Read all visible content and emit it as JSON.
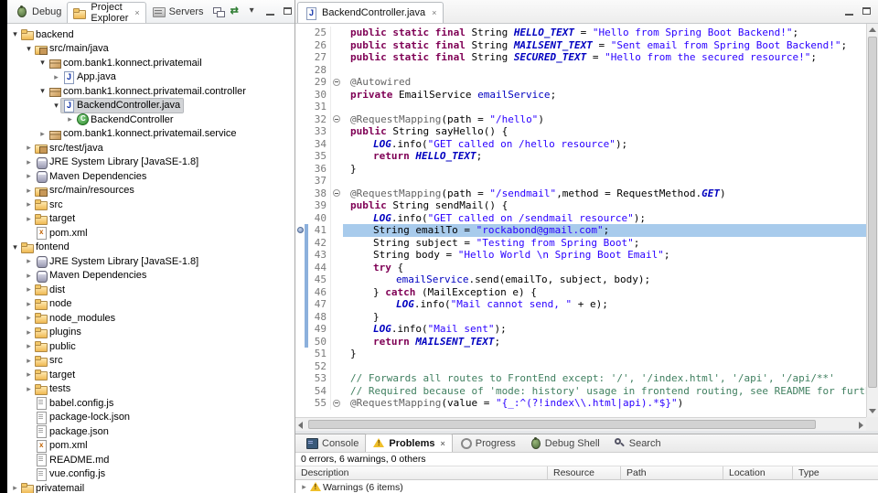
{
  "left_toolbar": {
    "tabs": [
      {
        "label": "Debug",
        "icon": "bug",
        "active": false,
        "closable": false
      },
      {
        "label": "Project Explorer",
        "icon": "explorer",
        "active": true,
        "closable": true
      },
      {
        "label": "Servers",
        "icon": "server",
        "active": false,
        "closable": false
      }
    ],
    "actions": [
      "collapse-all",
      "link-with-editor",
      "view-menu",
      "minimize",
      "maximize"
    ]
  },
  "project_tree": {
    "items": [
      {
        "label": "backend",
        "depth": 0,
        "state": "e",
        "icon": "prj"
      },
      {
        "label": "src/main/java",
        "depth": 1,
        "state": "e",
        "icon": "srcf"
      },
      {
        "label": "com.bank1.konnect.privatemail",
        "depth": 2,
        "state": "e",
        "icon": "pkg"
      },
      {
        "label": "App.java",
        "depth": 3,
        "state": "c",
        "icon": "jfile"
      },
      {
        "label": "com.bank1.konnect.privatemail.controller",
        "depth": 2,
        "state": "e",
        "icon": "pkg"
      },
      {
        "label": "BackendController.java",
        "depth": 3,
        "state": "e",
        "icon": "jfile",
        "sel": true
      },
      {
        "label": "BackendController",
        "depth": 4,
        "state": "c",
        "icon": "cls"
      },
      {
        "label": "com.bank1.konnect.privatemail.service",
        "depth": 2,
        "state": "c",
        "icon": "pkg"
      },
      {
        "label": "src/test/java",
        "depth": 1,
        "state": "c",
        "icon": "srcf"
      },
      {
        "label": "JRE System Library [JavaSE-1.8]",
        "depth": 1,
        "state": "c",
        "icon": "lib"
      },
      {
        "label": "Maven Dependencies",
        "depth": 1,
        "state": "c",
        "icon": "lib"
      },
      {
        "label": "src/main/resources",
        "depth": 1,
        "state": "c",
        "icon": "srcf"
      },
      {
        "label": "src",
        "depth": 1,
        "state": "c",
        "icon": "fold"
      },
      {
        "label": "target",
        "depth": 1,
        "state": "c",
        "icon": "fold"
      },
      {
        "label": "pom.xml",
        "depth": 1,
        "state": "",
        "icon": "xml"
      },
      {
        "label": "fontend",
        "depth": 0,
        "state": "e",
        "icon": "prj"
      },
      {
        "label": "JRE System Library [JavaSE-1.8]",
        "depth": 1,
        "state": "c",
        "icon": "lib"
      },
      {
        "label": "Maven Dependencies",
        "depth": 1,
        "state": "c",
        "icon": "lib"
      },
      {
        "label": "dist",
        "depth": 1,
        "state": "c",
        "icon": "fold"
      },
      {
        "label": "node",
        "depth": 1,
        "state": "c",
        "icon": "fold"
      },
      {
        "label": "node_modules",
        "depth": 1,
        "state": "c",
        "icon": "fold"
      },
      {
        "label": "plugins",
        "depth": 1,
        "state": "c",
        "icon": "fold"
      },
      {
        "label": "public",
        "depth": 1,
        "state": "c",
        "icon": "fold"
      },
      {
        "label": "src",
        "depth": 1,
        "state": "c",
        "icon": "fold"
      },
      {
        "label": "target",
        "depth": 1,
        "state": "c",
        "icon": "fold"
      },
      {
        "label": "tests",
        "depth": 1,
        "state": "c",
        "icon": "fold"
      },
      {
        "label": "babel.config.js",
        "depth": 1,
        "state": "",
        "icon": "file"
      },
      {
        "label": "package-lock.json",
        "depth": 1,
        "state": "",
        "icon": "file"
      },
      {
        "label": "package.json",
        "depth": 1,
        "state": "",
        "icon": "file"
      },
      {
        "label": "pom.xml",
        "depth": 1,
        "state": "",
        "icon": "xml"
      },
      {
        "label": "README.md",
        "depth": 1,
        "state": "",
        "icon": "file"
      },
      {
        "label": "vue.config.js",
        "depth": 1,
        "state": "",
        "icon": "file"
      },
      {
        "label": "privatemail",
        "depth": 0,
        "state": "c",
        "icon": "prj"
      }
    ]
  },
  "editor": {
    "tab_label": "BackendController.java",
    "lines": [
      {
        "n": 25,
        "ind": 0,
        "seg": [
          [
            "k",
            "public static final "
          ],
          [
            "d",
            "String "
          ],
          [
            "sf",
            "HELLO_TEXT"
          ],
          [
            "d",
            " = "
          ],
          [
            "s",
            "\"Hello from Spring Boot Backend!\""
          ],
          [
            "d",
            ";"
          ]
        ]
      },
      {
        "n": 26,
        "ind": 0,
        "seg": [
          [
            "k",
            "public static final "
          ],
          [
            "d",
            "String "
          ],
          [
            "sf",
            "MAILSENT_TEXT"
          ],
          [
            "d",
            " = "
          ],
          [
            "s",
            "\"Sent email from Spring Boot Backend!\""
          ],
          [
            "d",
            ";"
          ]
        ]
      },
      {
        "n": 27,
        "ind": 0,
        "seg": [
          [
            "k",
            "public static final "
          ],
          [
            "d",
            "String "
          ],
          [
            "sf",
            "SECURED_TEXT"
          ],
          [
            "d",
            " = "
          ],
          [
            "s",
            "\"Hello from the secured resource!\""
          ],
          [
            "d",
            ";"
          ]
        ]
      },
      {
        "n": 28,
        "ind": 0,
        "seg": []
      },
      {
        "n": 29,
        "ind": 0,
        "fold": true,
        "seg": [
          [
            "a",
            "@Autowired"
          ]
        ]
      },
      {
        "n": 30,
        "ind": 0,
        "seg": [
          [
            "k",
            "private "
          ],
          [
            "d",
            "EmailService "
          ],
          [
            "fl",
            "emailService"
          ],
          [
            "d",
            ";"
          ]
        ]
      },
      {
        "n": 31,
        "ind": 0,
        "seg": []
      },
      {
        "n": 32,
        "ind": 0,
        "fold": true,
        "seg": [
          [
            "a",
            "@RequestMapping"
          ],
          [
            "d",
            "(path = "
          ],
          [
            "s",
            "\"/hello\""
          ],
          [
            "d",
            ")"
          ]
        ]
      },
      {
        "n": 33,
        "ind": 0,
        "seg": [
          [
            "k",
            "public "
          ],
          [
            "d",
            "String sayHello() {"
          ]
        ]
      },
      {
        "n": 34,
        "ind": 1,
        "seg": [
          [
            "sf",
            "LOG"
          ],
          [
            "d",
            ".info("
          ],
          [
            "s",
            "\"GET called on /hello resource\""
          ],
          [
            "d",
            ");"
          ]
        ]
      },
      {
        "n": 35,
        "ind": 1,
        "seg": [
          [
            "k",
            "return "
          ],
          [
            "sf",
            "HELLO_TEXT"
          ],
          [
            "d",
            ";"
          ]
        ]
      },
      {
        "n": 36,
        "ind": 0,
        "seg": [
          [
            "d",
            "}"
          ]
        ]
      },
      {
        "n": 37,
        "ind": 0,
        "seg": []
      },
      {
        "n": 38,
        "ind": 0,
        "fold": true,
        "seg": [
          [
            "a",
            "@RequestMapping"
          ],
          [
            "d",
            "(path = "
          ],
          [
            "s",
            "\"/sendmail\""
          ],
          [
            "d",
            ",method = RequestMethod."
          ],
          [
            "sf",
            "GET"
          ],
          [
            "d",
            ")"
          ]
        ]
      },
      {
        "n": 39,
        "ind": 0,
        "seg": [
          [
            "k",
            "public "
          ],
          [
            "d",
            "String sendMail() {"
          ]
        ]
      },
      {
        "n": 40,
        "ind": 1,
        "seg": [
          [
            "sf",
            "LOG"
          ],
          [
            "d",
            ".info("
          ],
          [
            "s",
            "\"GET called on /sendmail resource\""
          ],
          [
            "d",
            ");"
          ]
        ]
      },
      {
        "n": 41,
        "ind": 1,
        "hl": true,
        "mark": true,
        "diff": true,
        "seg": [
          [
            "d",
            "String emailTo = "
          ],
          [
            "s",
            "\"rockabond@gmail.com\""
          ],
          [
            "d",
            ";"
          ]
        ]
      },
      {
        "n": 42,
        "ind": 1,
        "diff": true,
        "seg": [
          [
            "d",
            "String subject = "
          ],
          [
            "s",
            "\"Testing from Spring Boot\""
          ],
          [
            "d",
            ";"
          ]
        ]
      },
      {
        "n": 43,
        "ind": 1,
        "diff": true,
        "seg": [
          [
            "d",
            "String body = "
          ],
          [
            "s",
            "\"Hello World \\n Spring Boot Email\""
          ],
          [
            "d",
            ";"
          ]
        ]
      },
      {
        "n": 44,
        "ind": 1,
        "diff": true,
        "seg": [
          [
            "k",
            "try"
          ],
          [
            "d",
            " {"
          ]
        ]
      },
      {
        "n": 45,
        "ind": 2,
        "diff": true,
        "seg": [
          [
            "fl",
            "emailService"
          ],
          [
            "d",
            ".send(emailTo, subject, body);"
          ]
        ]
      },
      {
        "n": 46,
        "ind": 1,
        "diff": true,
        "seg": [
          [
            "d",
            "} "
          ],
          [
            "k",
            "catch"
          ],
          [
            "d",
            " (MailException e) {"
          ]
        ]
      },
      {
        "n": 47,
        "ind": 2,
        "diff": true,
        "seg": [
          [
            "sf",
            "LOG"
          ],
          [
            "d",
            ".info("
          ],
          [
            "s",
            "\"Mail cannot send, \""
          ],
          [
            "d",
            " + e);"
          ]
        ]
      },
      {
        "n": 48,
        "ind": 1,
        "diff": true,
        "seg": [
          [
            "d",
            "}"
          ]
        ]
      },
      {
        "n": 49,
        "ind": 1,
        "diff": true,
        "seg": [
          [
            "sf",
            "LOG"
          ],
          [
            "d",
            ".info("
          ],
          [
            "s",
            "\"Mail sent\""
          ],
          [
            "d",
            ");"
          ]
        ]
      },
      {
        "n": 50,
        "ind": 1,
        "diff": true,
        "seg": [
          [
            "k",
            "return "
          ],
          [
            "sf",
            "MAILSENT_TEXT"
          ],
          [
            "d",
            ";"
          ]
        ]
      },
      {
        "n": 51,
        "ind": 0,
        "seg": [
          [
            "d",
            "}"
          ]
        ]
      },
      {
        "n": 52,
        "ind": 0,
        "seg": []
      },
      {
        "n": 53,
        "ind": 0,
        "seg": [
          [
            "c",
            "// Forwards all routes to FrontEnd except: '/', '/index.html', '/api', '/api/**'"
          ]
        ]
      },
      {
        "n": 54,
        "ind": 0,
        "seg": [
          [
            "c",
            "// Required because of 'mode: history' usage in frontend routing, see README for further d"
          ]
        ]
      },
      {
        "n": 55,
        "ind": 0,
        "fold": true,
        "seg": [
          [
            "a",
            "@RequestMapping"
          ],
          [
            "d",
            "(value = "
          ],
          [
            "s",
            "\"{_:^(?!index\\\\.html|api).*$}\""
          ],
          [
            "d",
            ")"
          ]
        ]
      }
    ]
  },
  "bottom_panel": {
    "tabs": [
      {
        "label": "Console",
        "icon": "console",
        "active": false
      },
      {
        "label": "Problems",
        "icon": "problems",
        "active": true,
        "closable": true
      },
      {
        "label": "Progress",
        "icon": "progress",
        "active": false
      },
      {
        "label": "Debug Shell",
        "icon": "debug-shell",
        "active": false
      },
      {
        "label": "Search",
        "icon": "search",
        "active": false
      }
    ],
    "summary": "0 errors, 6 warnings, 0 others",
    "columns": [
      "Description",
      "Resource",
      "Path",
      "Location",
      "Type"
    ],
    "rows": [
      {
        "label": "Warnings (6 items)",
        "icon": "warning",
        "expandable": true
      }
    ]
  }
}
